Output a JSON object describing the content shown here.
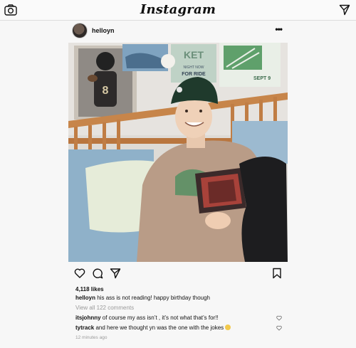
{
  "app": {
    "title": "Instagram",
    "icons": {
      "camera": "camera-icon",
      "send": "send-icon"
    }
  },
  "post": {
    "username": "helloyn",
    "options_label": "•••",
    "likes": "4,118 likes",
    "caption": {
      "user": "helloyn",
      "text": " his ass is not reading! happy birthday though"
    },
    "view_all": "View all 122 comments",
    "comments": [
      {
        "user": "itsjohnny",
        "text": " of course my ass isn’t , it’s not what that’s for!!"
      },
      {
        "user": "tytrack",
        "text": " and here we thought yn was the one with the jokes "
      }
    ],
    "timestamp": "12 minutes ago",
    "poster_text": {
      "line1": "NIGHT NOW",
      "line2": "FOR RIDE",
      "big": "KET",
      "sept": "SEPT 9"
    }
  },
  "colors": {
    "background": "#f7f7f7",
    "text": "#111111",
    "muted": "#9a9a9a"
  }
}
